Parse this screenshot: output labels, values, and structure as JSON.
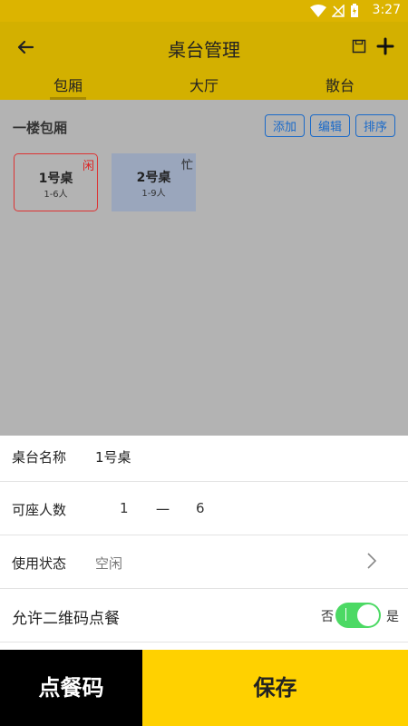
{
  "status_bar": {
    "time": "3:27",
    "icons": [
      "wifi-icon",
      "no-signal-icon",
      "battery-icon"
    ]
  },
  "app_bar": {
    "title": "桌台管理",
    "icons": [
      "back-arrow-icon",
      "save-icon",
      "add-icon"
    ]
  },
  "tabs": [
    {
      "label": "包厢",
      "active": true
    },
    {
      "label": "大厅",
      "active": false
    },
    {
      "label": "散台",
      "active": false
    }
  ],
  "section": {
    "floor_label": "一楼包厢",
    "actions": {
      "add": "添加",
      "edit": "编辑",
      "sort": "排序"
    }
  },
  "tables": [
    {
      "name": "1号桌",
      "capacity": "1-6人",
      "state": "闲"
    },
    {
      "name": "2号桌",
      "capacity": "1-9人",
      "state": "忙"
    }
  ],
  "form": {
    "name": {
      "label": "桌台名称",
      "value": "1号桌"
    },
    "capacity": {
      "label": "可座人数",
      "min": "1",
      "separator": "一",
      "max": "6"
    },
    "status": {
      "label": "使用状态",
      "value": "空闲"
    },
    "qr_order": {
      "label": "允许二维码点餐",
      "off_label": "否",
      "on_label": "是",
      "enabled": true
    }
  },
  "bottom": {
    "order_button": "点餐码",
    "save_button": "保存"
  },
  "colors": {
    "appbar": "#d3b000",
    "save_button": "#ffd100",
    "order_button": "#000000",
    "toggle_on": "#4cd964",
    "link_blue": "#1a6ac9"
  }
}
